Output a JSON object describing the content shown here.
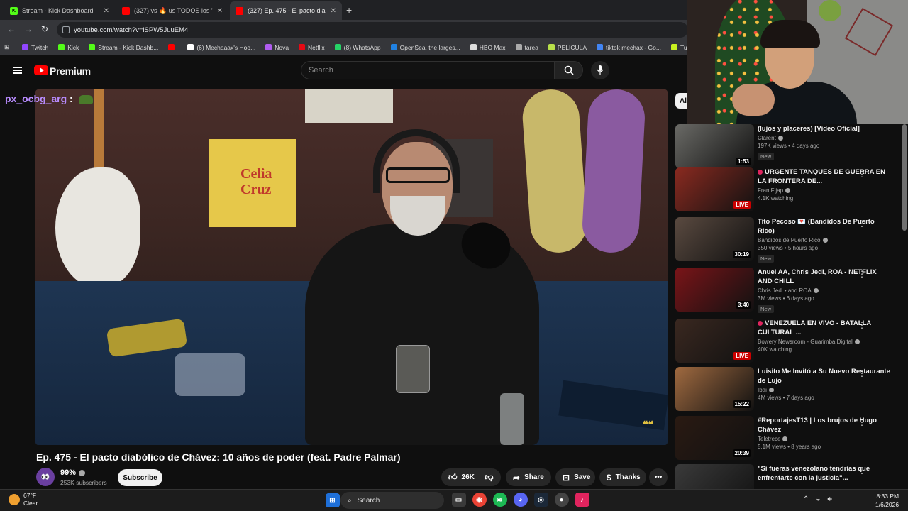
{
  "browser": {
    "tabs": [
      {
        "title": "Stream - Kick Dashboard",
        "icon": "kick-icon",
        "color": "#53fc18"
      },
      {
        "title": "(327) vs 🔥 us TODOS los \"DETA",
        "icon": "youtube-icon",
        "color": "#ff0000"
      },
      {
        "title": "(327) Ep. 475 - El pacto diabólic",
        "icon": "youtube-icon",
        "color": "#ff0000"
      }
    ],
    "new_tab": "+",
    "url": "youtube.com/watch?v=iSPW5JuuEM4",
    "bookmarks": [
      {
        "label": "Twitch",
        "color": "#9146ff"
      },
      {
        "label": "Kick",
        "color": "#53fc18"
      },
      {
        "label": "Stream - Kick Dashb...",
        "color": "#53fc18"
      },
      {
        "label": "",
        "color": "#ff0000"
      },
      {
        "label": "(6) Mechaaax's Hoo...",
        "color": "#ffffff"
      },
      {
        "label": "Nova",
        "color": "#b05cf0"
      },
      {
        "label": "Netflix",
        "color": "#e50914"
      },
      {
        "label": "(8) WhatsApp",
        "color": "#25d366"
      },
      {
        "label": "OpenSea, the larges...",
        "color": "#2081e2"
      },
      {
        "label": "HBO Max",
        "color": "#dddddd"
      },
      {
        "label": "tarea",
        "color": "#aaaaaa"
      },
      {
        "label": "PELICULA",
        "color": "#b8e04a"
      },
      {
        "label": "tiktok mechax - Go...",
        "color": "#4285f4"
      },
      {
        "label": "Turn Your Skins int",
        "color": "#c8f020"
      }
    ]
  },
  "youtube": {
    "brand": "Premium",
    "search_placeholder": "Search",
    "chat_user": "px_ocbg_arg",
    "chat_sep": ":",
    "video_title": "Ep. 475 - El pacto diabólico de Chávez: 10 años de poder (feat. Padre Palmar)",
    "channel_name": "99%",
    "subscribers": "253K subscribers",
    "subscribe": "Subscribe",
    "likes": "26K",
    "share": "Share",
    "save": "Save",
    "thanks": "Thanks",
    "filter_chip": "All"
  },
  "poster_text": "Celia Cruz",
  "recommendations": [
    {
      "title": "(lujos y placeres) [Video Oficial]",
      "channel": "Clarent",
      "meta": "197K views • 4 days ago",
      "badge": "New",
      "duration": "1:53",
      "live": false,
      "thumb": "#6a6a66",
      "dots": false
    },
    {
      "title": "URGENTE TANQUES DE GUERRA EN LA FRONTERA DE...",
      "channel": "Fran Fijap",
      "meta": "4.1K watching",
      "badge": "",
      "duration": "LIVE",
      "live": true,
      "thumb": "#8a2a20",
      "dots": true
    },
    {
      "title": "Tito Pecoso 💌 (Bandidos De Puerto Rico)",
      "channel": "Bandidos de Puerto Rico",
      "meta": "350 views • 5 hours ago",
      "badge": "New",
      "duration": "30:19",
      "live": false,
      "thumb": "#5a4a40",
      "dots": true
    },
    {
      "title": "Anuel AA, Chris Jedi, ROA - NETFLIX AND CHILL",
      "channel": "Chris Jedi • and ROA",
      "meta": "3M views • 6 days ago",
      "badge": "New",
      "duration": "3:40",
      "live": false,
      "thumb": "#7a1418",
      "dots": true
    },
    {
      "title": "VENEZUELA EN VIVO - BATALLA CULTURAL ...",
      "channel": "Bowery Newsroom - Guarimba Digital",
      "meta": "40K watching",
      "badge": "",
      "duration": "LIVE",
      "live": true,
      "thumb": "#3a2820",
      "dots": true
    },
    {
      "title": "Luisito Me Invitó a Su Nuevo Restaurante de Lujo",
      "channel": "Ibai",
      "meta": "4M views • 7 days ago",
      "badge": "",
      "duration": "15:22",
      "live": false,
      "thumb": "#a06a40",
      "dots": true
    },
    {
      "title": "#ReportajesT13 | Los brujos de Hugo Chávez",
      "channel": "Teletrece",
      "meta": "5.1M views • 8 years ago",
      "badge": "",
      "duration": "20:39",
      "live": false,
      "thumb": "#2a1a12",
      "dots": true
    },
    {
      "title": "\"Si fueras venezolano tendrías que enfrentarte con la justicia\"...",
      "channel": "",
      "meta": "",
      "badge": "",
      "duration": "",
      "live": false,
      "thumb": "#3a3a3a",
      "dots": true
    }
  ],
  "taskbar": {
    "temp": "67°F",
    "weather": "Clear",
    "search": "Search",
    "time": "8:33 PM",
    "date": "1/6/2026"
  }
}
